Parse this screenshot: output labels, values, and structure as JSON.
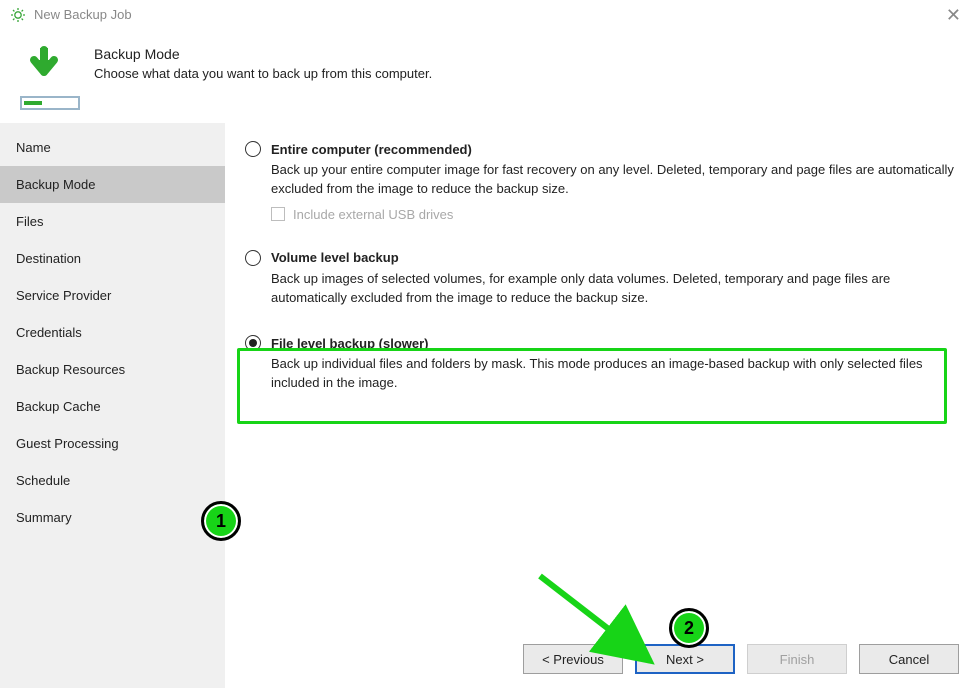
{
  "window": {
    "title": "New Backup Job"
  },
  "header": {
    "title": "Backup Mode",
    "subtitle": "Choose what data you want to back up from this computer."
  },
  "sidebar": {
    "items": [
      {
        "label": "Name",
        "selected": false
      },
      {
        "label": "Backup Mode",
        "selected": true
      },
      {
        "label": "Files",
        "selected": false
      },
      {
        "label": "Destination",
        "selected": false
      },
      {
        "label": "Service Provider",
        "selected": false
      },
      {
        "label": "Credentials",
        "selected": false
      },
      {
        "label": "Backup Resources",
        "selected": false
      },
      {
        "label": "Backup Cache",
        "selected": false
      },
      {
        "label": "Guest Processing",
        "selected": false
      },
      {
        "label": "Schedule",
        "selected": false
      },
      {
        "label": "Summary",
        "selected": false
      }
    ]
  },
  "options": {
    "entire": {
      "title": "Entire computer (recommended)",
      "desc": "Back up your entire computer image for fast recovery on any level. Deleted, temporary and page files are automatically excluded from the image to reduce the backup size.",
      "sub_checkbox_label": "Include external USB drives",
      "checked": false
    },
    "volume": {
      "title": "Volume level backup",
      "desc": "Back up images of selected volumes, for example only data volumes. Deleted, temporary and page files are automatically excluded from the image to reduce the backup size.",
      "checked": false
    },
    "file": {
      "title": "File level backup (slower)",
      "desc": "Back up individual files and folders by mask. This mode produces an image-based backup with only selected files included in the image.",
      "checked": true
    }
  },
  "footer": {
    "previous": "< Previous",
    "next": "Next >",
    "finish": "Finish",
    "cancel": "Cancel"
  },
  "annotations": {
    "badge1": "1",
    "badge2": "2"
  }
}
